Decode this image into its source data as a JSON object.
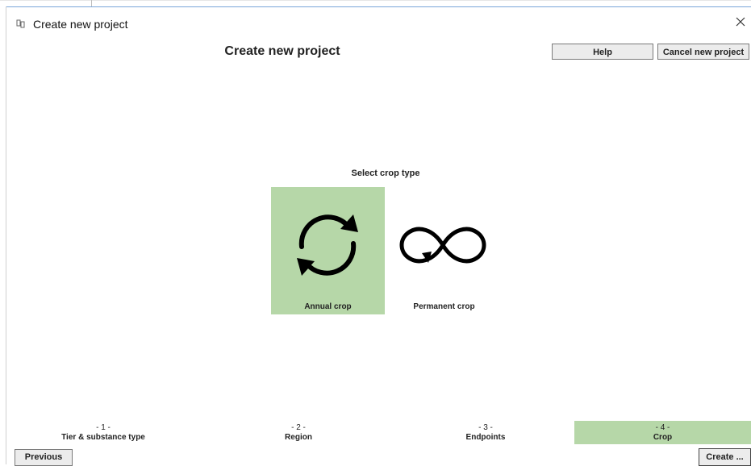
{
  "window": {
    "title": "Create new project",
    "close_icon": "close-icon",
    "app_icon": "app-icon"
  },
  "header": {
    "title": "Create new project",
    "help_label": "Help",
    "cancel_label": "Cancel new project"
  },
  "main": {
    "section_label": "Select crop type",
    "options": [
      {
        "label": "Annual crop",
        "icon": "cycle-arrows-icon",
        "selected": true
      },
      {
        "label": "Permanent crop",
        "icon": "infinity-arrow-icon",
        "selected": false
      }
    ]
  },
  "steps": [
    {
      "number": "- 1 -",
      "label": "Tier & substance type",
      "active": false
    },
    {
      "number": "- 2 -",
      "label": "Region",
      "active": false
    },
    {
      "number": "- 3 -",
      "label": "Endpoints",
      "active": false
    },
    {
      "number": "- 4 -",
      "label": "Crop",
      "active": true
    }
  ],
  "footer": {
    "previous_label": "Previous",
    "create_label": "Create ..."
  },
  "colors": {
    "selected_bg": "#b6d7a8",
    "button_bg": "#ececec"
  }
}
